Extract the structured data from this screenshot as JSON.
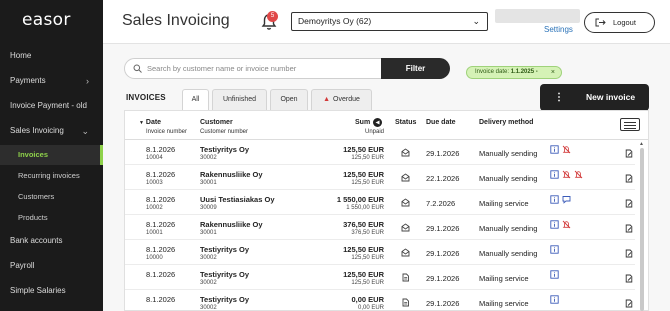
{
  "app": {
    "logo": "easor",
    "title": "Sales Invoicing",
    "notification_count": "5",
    "company": "Demoyritys Oy (62)",
    "settings": "Settings",
    "logout": "Logout"
  },
  "sidebar": {
    "items": [
      {
        "label": "Home"
      },
      {
        "label": "Payments"
      },
      {
        "label": "Invoice Payment - old"
      },
      {
        "label": "Sales Invoicing"
      },
      {
        "label": "Bank accounts"
      },
      {
        "label": "Payroll"
      },
      {
        "label": "Simple Salaries"
      }
    ],
    "sub": [
      {
        "label": "Invoices",
        "active": true
      },
      {
        "label": "Recurring invoices"
      },
      {
        "label": "Customers"
      },
      {
        "label": "Products"
      }
    ]
  },
  "toolbar": {
    "search_placeholder": "Search by customer name or invoice number",
    "filter": "Filter",
    "chip_label": "Invoice date:",
    "chip_value": "1.1.2025 -",
    "chip_close": "×"
  },
  "invoices": {
    "heading": "INVOICES",
    "tabs": [
      "All",
      "Unfinished",
      "Open",
      "Overdue"
    ],
    "new_invoice": "New invoice",
    "columns": {
      "date": "Date",
      "invoice_number": "Invoice number",
      "customer": "Customer",
      "customer_number": "Customer number",
      "sum": "Sum",
      "unpaid": "Unpaid",
      "status": "Status",
      "due": "Due date",
      "delivery": "Delivery method"
    },
    "rows": [
      {
        "date": "8.1.2026",
        "num": "10004",
        "customer": "Testiyritys Oy",
        "cnum": "30002",
        "sum": "125,50 EUR",
        "unpaid": "125,50 EUR",
        "status": "envelope",
        "due": "29.1.2026",
        "delivery": "Manually sending",
        "icons": [
          "info",
          "bell-off"
        ]
      },
      {
        "date": "8.1.2026",
        "num": "10003",
        "customer": "Rakennusliike Oy",
        "cnum": "30001",
        "sum": "125,50 EUR",
        "unpaid": "125,50 EUR",
        "status": "envelope",
        "due": "22.1.2026",
        "delivery": "Manually sending",
        "icons": [
          "info",
          "bell-off",
          "bell-off"
        ]
      },
      {
        "date": "8.1.2026",
        "num": "10002",
        "customer": "Uusi Testiasiakas Oy",
        "cnum": "30009",
        "sum": "1 550,00 EUR",
        "unpaid": "1 550,00 EUR",
        "status": "envelope",
        "due": "7.2.2026",
        "delivery": "Mailing service",
        "icons": [
          "info",
          "comment"
        ]
      },
      {
        "date": "8.1.2026",
        "num": "10001",
        "customer": "Rakennusliike Oy",
        "cnum": "30001",
        "sum": "376,50 EUR",
        "unpaid": "376,50 EUR",
        "status": "envelope",
        "due": "29.1.2026",
        "delivery": "Manually sending",
        "icons": [
          "info",
          "bell-off"
        ]
      },
      {
        "date": "8.1.2026",
        "num": "10000",
        "customer": "Testiyritys Oy",
        "cnum": "30002",
        "sum": "125,50 EUR",
        "unpaid": "125,50 EUR",
        "status": "envelope",
        "due": "29.1.2026",
        "delivery": "Manually sending",
        "icons": [
          "info"
        ]
      },
      {
        "date": "8.1.2026",
        "num": "",
        "customer": "Testiyritys Oy",
        "cnum": "30002",
        "sum": "125,50 EUR",
        "unpaid": "125,50 EUR",
        "status": "document",
        "due": "29.1.2026",
        "delivery": "Mailing service",
        "icons": [
          "info"
        ]
      },
      {
        "date": "8.1.2026",
        "num": "",
        "customer": "Testiyritys Oy",
        "cnum": "30002",
        "sum": "0,00 EUR",
        "unpaid": "0,00 EUR",
        "status": "document",
        "due": "29.1.2026",
        "delivery": "Mailing service",
        "icons": [
          "info"
        ]
      }
    ]
  },
  "colors": {
    "sidebar_bg": "#1b1b1b",
    "accent_green": "#8ed14a",
    "badge_red": "#e04848",
    "chip_bg": "#d5f2b6",
    "icon_blue": "#3b5bb8",
    "bell_off_red": "#d23a3a"
  }
}
